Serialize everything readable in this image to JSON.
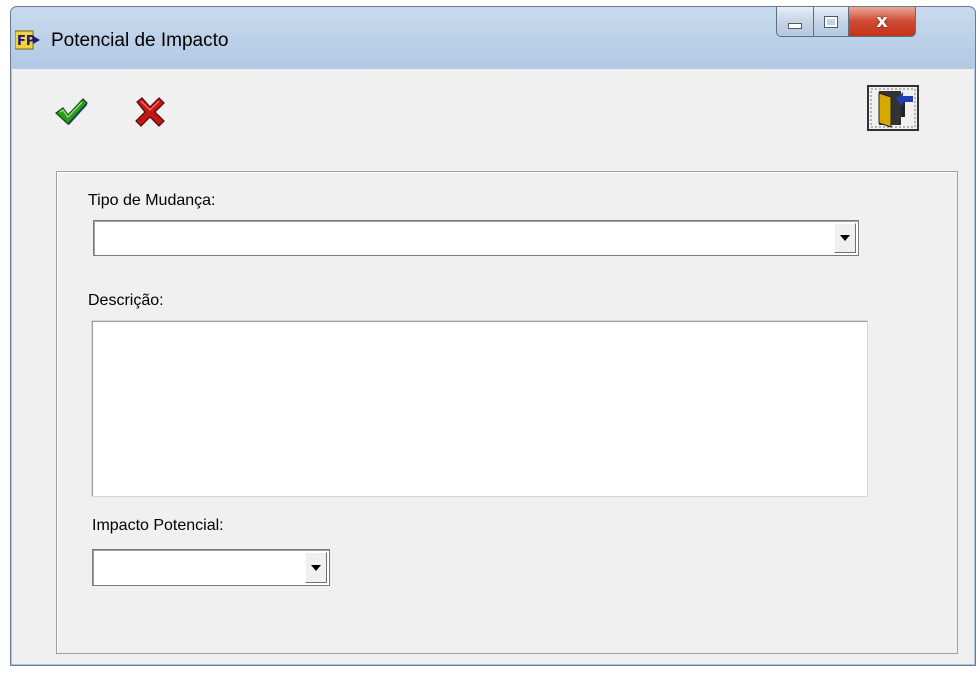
{
  "window": {
    "title": "Potencial de Impacto",
    "icon": "fp-app-icon",
    "controls": {
      "minimize": "minimize-icon",
      "maximize": "maximize-icon",
      "close": "x"
    }
  },
  "toolbar": {
    "confirm_icon": "checkmark-icon",
    "cancel_icon": "red-x-icon",
    "exit_icon": "exit-door-icon"
  },
  "form": {
    "tipo_mudanca": {
      "label": "Tipo de Mudança:",
      "value": ""
    },
    "descricao": {
      "label": "Descrição:",
      "value": ""
    },
    "impacto_potencial": {
      "label": "Impacto Potencial:",
      "value": ""
    }
  },
  "colors": {
    "title_bar": "#b9cfe7",
    "client_bg": "#f0f0f0",
    "close_button": "#c9442a",
    "check_green": "#2e9a1e",
    "x_red": "#c01818"
  }
}
